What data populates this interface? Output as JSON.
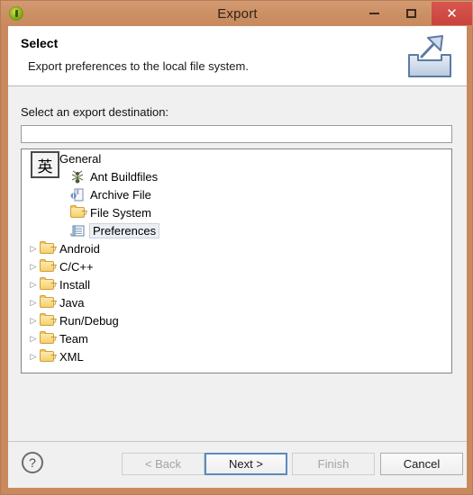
{
  "window": {
    "title": "Export",
    "app_icon": "eclipse-icon",
    "controls": {
      "minimize": "minimize-icon",
      "maximize": "maximize-icon",
      "close": "✕"
    },
    "titlebar_color": "#cb8f63",
    "close_color": "#c9423c"
  },
  "header": {
    "title": "Select",
    "description": "Export preferences to the local file system.",
    "icon": "export-wizard-icon"
  },
  "main": {
    "destination_label": "Select an export destination:",
    "filter": {
      "value": "",
      "placeholder": ""
    },
    "tree": [
      {
        "label": "General",
        "level": 0,
        "icon": "folder-open-icon",
        "expanded": true,
        "selected": false,
        "has_children": true
      },
      {
        "label": "Ant Buildfiles",
        "level": 1,
        "icon": "ant-icon",
        "expanded": false,
        "selected": false,
        "has_children": false
      },
      {
        "label": "Archive File",
        "level": 1,
        "icon": "archive-file-icon",
        "expanded": false,
        "selected": false,
        "has_children": false
      },
      {
        "label": "File System",
        "level": 1,
        "icon": "folder-icon",
        "expanded": false,
        "selected": false,
        "has_children": false
      },
      {
        "label": "Preferences",
        "level": 1,
        "icon": "preferences-icon",
        "expanded": false,
        "selected": true,
        "has_children": false
      },
      {
        "label": "Android",
        "level": 0,
        "icon": "folder-icon",
        "expanded": false,
        "selected": false,
        "has_children": true
      },
      {
        "label": "C/C++",
        "level": 0,
        "icon": "folder-icon",
        "expanded": false,
        "selected": false,
        "has_children": true
      },
      {
        "label": "Install",
        "level": 0,
        "icon": "folder-icon",
        "expanded": false,
        "selected": false,
        "has_children": true
      },
      {
        "label": "Java",
        "level": 0,
        "icon": "folder-icon",
        "expanded": false,
        "selected": false,
        "has_children": true
      },
      {
        "label": "Run/Debug",
        "level": 0,
        "icon": "folder-icon",
        "expanded": false,
        "selected": false,
        "has_children": true
      },
      {
        "label": "Team",
        "level": 0,
        "icon": "folder-icon",
        "expanded": false,
        "selected": false,
        "has_children": true
      },
      {
        "label": "XML",
        "level": 0,
        "icon": "folder-icon",
        "expanded": false,
        "selected": false,
        "has_children": true
      }
    ],
    "ime_indicator": "英"
  },
  "footer": {
    "help": "?",
    "back": "< Back",
    "next": "Next >",
    "finish": "Finish",
    "cancel": "Cancel"
  }
}
